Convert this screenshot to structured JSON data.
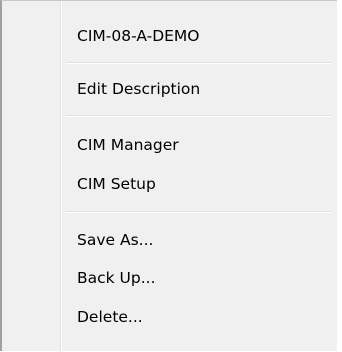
{
  "context_menu": {
    "items": [
      {
        "label": "CIM-08-A-DEMO"
      },
      {
        "label": "Edit Description"
      },
      {
        "label": "CIM Manager"
      },
      {
        "label": "CIM Setup"
      },
      {
        "label": "Save As..."
      },
      {
        "label": "Back Up..."
      },
      {
        "label": "Delete..."
      }
    ]
  }
}
